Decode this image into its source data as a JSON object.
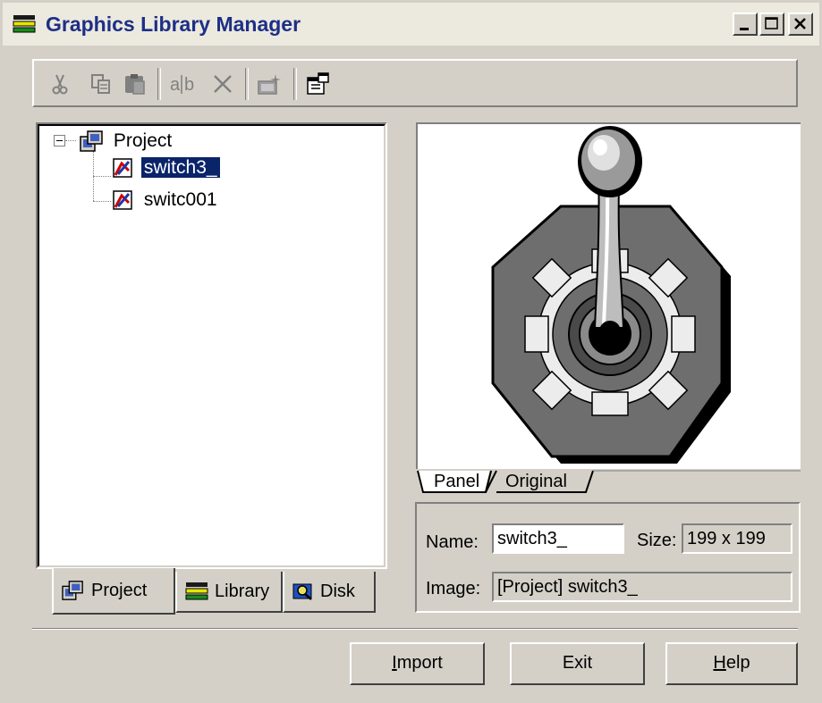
{
  "window": {
    "title": "Graphics Library Manager"
  },
  "toolbar": {
    "items": [
      "cut-icon",
      "copy-icon",
      "paste-icon",
      "rename-icon",
      "delete-icon",
      "new-image-icon",
      "properties-icon"
    ]
  },
  "tree": {
    "root": "Project",
    "items": [
      {
        "label": "switch3_",
        "selected": true
      },
      {
        "label": "switc001",
        "selected": false
      }
    ]
  },
  "left_tabs": [
    {
      "label": "Project",
      "active": true
    },
    {
      "label": "Library",
      "active": false
    },
    {
      "label": "Disk",
      "active": false
    }
  ],
  "preview_tabs": [
    {
      "label": "Panel",
      "active": true
    },
    {
      "label": "Original",
      "active": false
    }
  ],
  "info": {
    "name_label": "Name:",
    "name_value": "switch3_",
    "size_label": "Size:",
    "size_value": "199 x 199",
    "image_label": "Image:",
    "image_value": "[Project] switch3_"
  },
  "buttons": {
    "import": {
      "first": "I",
      "rest": "mport"
    },
    "exit": "Exit",
    "help": {
      "first": "H",
      "rest": "elp"
    }
  }
}
